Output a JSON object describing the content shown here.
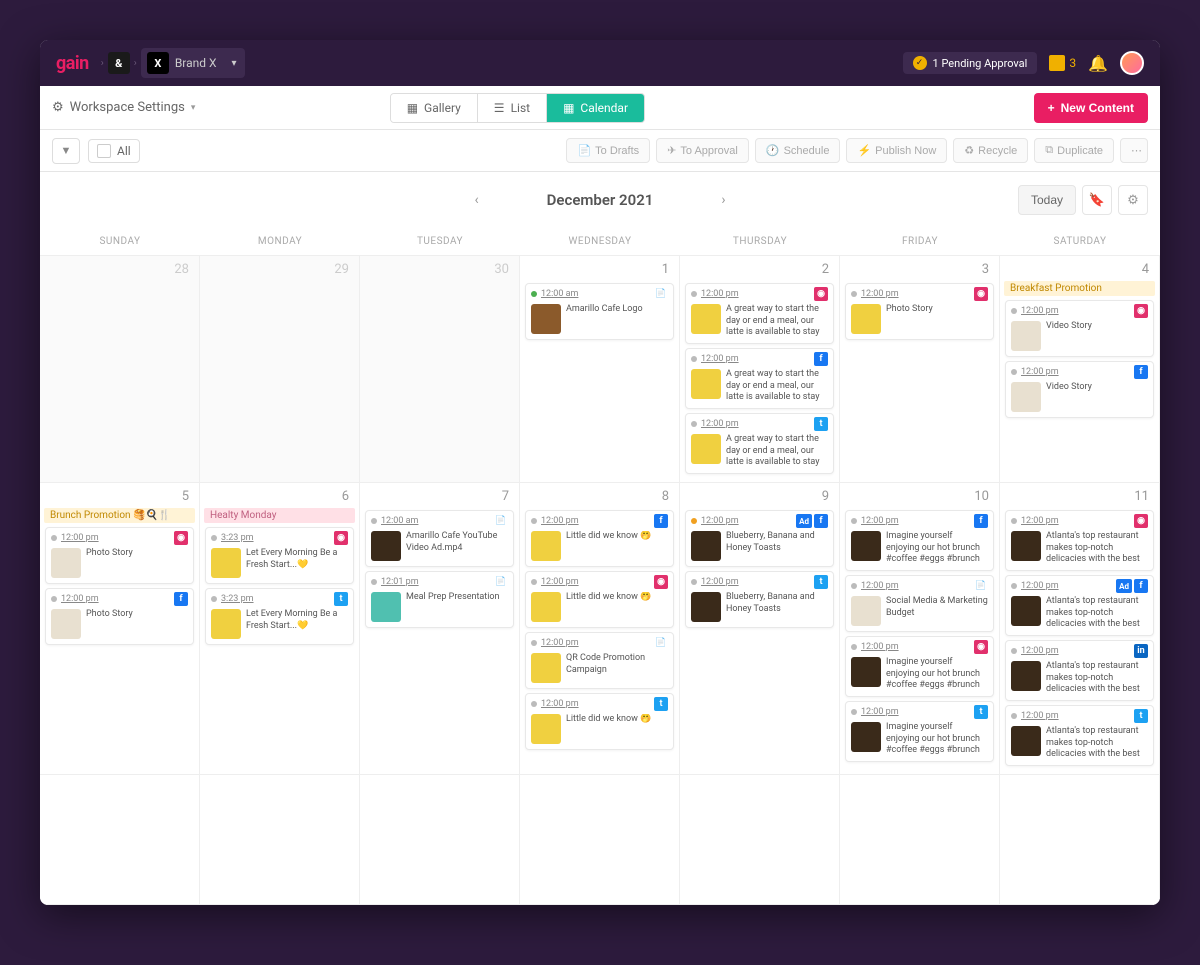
{
  "topbar": {
    "logo": "gain",
    "workspace_icon": "&",
    "brand_icon": "X",
    "brand_name": "Brand X",
    "pending_label": "1 Pending Approval",
    "tasks_count": "3"
  },
  "subbar": {
    "workspace_settings": "Workspace Settings",
    "tabs": {
      "gallery": "Gallery",
      "list": "List",
      "calendar": "Calendar"
    },
    "new_content": "New Content"
  },
  "toolbar": {
    "all": "All",
    "actions": [
      "To Drafts",
      "To Approval",
      "Schedule",
      "Publish Now",
      "Recycle",
      "Duplicate"
    ]
  },
  "calendar": {
    "title": "December 2021",
    "today": "Today",
    "dow": [
      "SUNDAY",
      "MONDAY",
      "TUESDAY",
      "WEDNESDAY",
      "THURSDAY",
      "FRIDAY",
      "SATURDAY"
    ]
  },
  "weeks": [
    [
      {
        "day": "28",
        "other": true,
        "cards": []
      },
      {
        "day": "29",
        "other": true,
        "cards": []
      },
      {
        "day": "30",
        "other": true,
        "cards": []
      },
      {
        "day": "1",
        "cards": [
          {
            "time": "12:00 am",
            "net": "file",
            "thumb": "brown",
            "text": "Amarillo Cafe Logo",
            "dot": "green"
          }
        ]
      },
      {
        "day": "2",
        "cards": [
          {
            "time": "12:00 pm",
            "net": "ig",
            "thumb": "yellow",
            "text": "A great way to start the day or end a meal, our latte is available to stay",
            "dot": "gray"
          },
          {
            "time": "12:00 pm",
            "net": "fb",
            "thumb": "yellow",
            "text": "A great way to start the day or end a meal, our latte is available to stay",
            "dot": "gray"
          },
          {
            "time": "12:00 pm",
            "net": "tw",
            "thumb": "yellow",
            "text": "A great way to start the day or end a meal, our latte is available to stay",
            "dot": "gray"
          }
        ]
      },
      {
        "day": "3",
        "cards": [
          {
            "time": "12:00 pm",
            "net": "ig",
            "thumb": "yellow",
            "text": "Photo Story",
            "dot": "gray"
          }
        ]
      },
      {
        "day": "4",
        "promo": {
          "type": "yellow",
          "label": "Breakfast Promotion"
        },
        "cards": [
          {
            "time": "12:00 pm",
            "net": "ig",
            "thumb": "light",
            "text": "Video Story",
            "dot": "gray"
          },
          {
            "time": "12:00 pm",
            "net": "fb",
            "thumb": "light",
            "text": "Video Story",
            "dot": "gray"
          }
        ]
      }
    ],
    [
      {
        "day": "5",
        "promo": {
          "type": "yellow",
          "label": "Brunch Promotion 🥞🍳🍴"
        },
        "cards": [
          {
            "time": "12:00 pm",
            "net": "ig",
            "thumb": "light",
            "text": "Photo Story",
            "dot": "gray"
          },
          {
            "time": "12:00 pm",
            "net": "fb",
            "thumb": "light",
            "text": "Photo Story",
            "dot": "gray"
          }
        ]
      },
      {
        "day": "6",
        "promo": {
          "type": "pink",
          "label": "Healty Monday"
        },
        "cards": [
          {
            "time": "3:23 pm",
            "net": "ig",
            "thumb": "yellow",
            "text": "Let Every Morning Be a Fresh Start...💛",
            "dot": "gray"
          },
          {
            "time": "3:23 pm",
            "net": "tw",
            "thumb": "yellow",
            "text": "Let Every Morning Be a Fresh Start...💛",
            "dot": "gray"
          }
        ]
      },
      {
        "day": "7",
        "cards": [
          {
            "time": "12:00 am",
            "net": "file",
            "thumb": "dark",
            "text": "Amarillo Cafe YouTube Video Ad.mp4",
            "dot": "gray"
          },
          {
            "time": "12:01 pm",
            "net": "file",
            "thumb": "teal",
            "text": "Meal Prep Presentation",
            "dot": "gray"
          }
        ]
      },
      {
        "day": "8",
        "cards": [
          {
            "time": "12:00 pm",
            "net": "fb",
            "thumb": "yellow",
            "text": "Little did we know 🤭",
            "dot": "gray"
          },
          {
            "time": "12:00 pm",
            "net": "ig",
            "thumb": "yellow",
            "text": "Little did we know 🤭",
            "dot": "gray"
          },
          {
            "time": "12:00 pm",
            "net": "file",
            "thumb": "yellow",
            "text": "QR Code Promotion Campaign",
            "dot": "gray"
          },
          {
            "time": "12:00 pm",
            "net": "tw",
            "thumb": "yellow",
            "text": "Little did we know 🤭",
            "dot": "gray"
          }
        ]
      },
      {
        "day": "9",
        "cards": [
          {
            "time": "12:00 pm",
            "net": "adfb",
            "thumb": "dark",
            "text": "Blueberry, Banana and Honey Toasts",
            "dot": "orange"
          },
          {
            "time": "12:00 pm",
            "net": "tw",
            "thumb": "dark",
            "text": "Blueberry, Banana and Honey Toasts",
            "dot": "gray"
          }
        ]
      },
      {
        "day": "10",
        "cards": [
          {
            "time": "12:00 pm",
            "net": "fb",
            "thumb": "dark",
            "text": "Imagine yourself enjoying our hot brunch #coffee #eggs #brunch #toasts",
            "dot": "gray"
          },
          {
            "time": "12:00 pm",
            "net": "file",
            "thumb": "light",
            "text": "Social Media & Marketing Budget",
            "dot": "gray"
          },
          {
            "time": "12:00 pm",
            "net": "ig",
            "thumb": "dark",
            "text": "Imagine yourself enjoying our hot brunch #coffee #eggs #brunch #toasts",
            "dot": "gray"
          },
          {
            "time": "12:00 pm",
            "net": "tw",
            "thumb": "dark",
            "text": "Imagine yourself enjoying our hot brunch #coffee #eggs #brunch #toasts",
            "dot": "gray"
          }
        ]
      },
      {
        "day": "11",
        "cards": [
          {
            "time": "12:00 pm",
            "net": "ig",
            "thumb": "dark",
            "text": "Atlanta's top restaurant makes top-notch delicacies with the best ingredients. I'm",
            "dot": "gray"
          },
          {
            "time": "12:00 pm",
            "net": "adfb",
            "thumb": "dark",
            "text": "Atlanta's top restaurant makes top-notch delicacies with the best ingredients.",
            "dot": "gray"
          },
          {
            "time": "12:00 pm",
            "net": "li",
            "thumb": "dark",
            "text": "Atlanta's top restaurant makes top-notch delicacies with the best ingredients.",
            "dot": "gray"
          },
          {
            "time": "12:00 pm",
            "net": "tw",
            "thumb": "dark",
            "text": "Atlanta's top restaurant makes top-notch delicacies with the best ingredients.",
            "dot": "gray"
          }
        ]
      }
    ],
    [
      {
        "day": "",
        "cards": []
      },
      {
        "day": "",
        "cards": []
      },
      {
        "day": "",
        "cards": []
      },
      {
        "day": "",
        "cards": []
      },
      {
        "day": "",
        "cards": []
      },
      {
        "day": "",
        "cards": []
      },
      {
        "day": "",
        "cards": []
      }
    ]
  ]
}
